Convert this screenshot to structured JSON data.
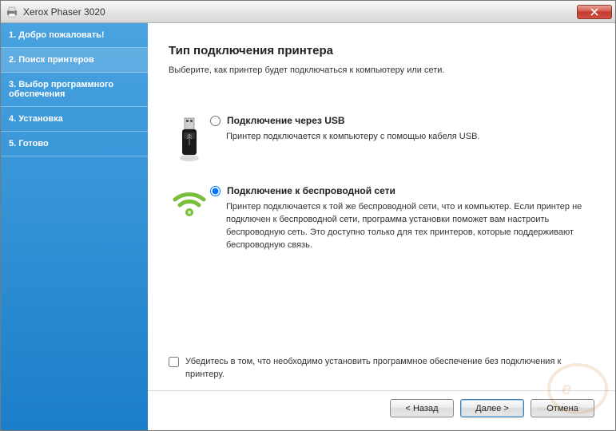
{
  "window": {
    "title": "Xerox Phaser 3020"
  },
  "sidebar": {
    "items": [
      {
        "label": "1. Добро пожаловать!"
      },
      {
        "label": "2. Поиск принтеров"
      },
      {
        "label": "3. Выбор программного обеспечения"
      },
      {
        "label": "4. Установка"
      },
      {
        "label": "5. Готово"
      }
    ]
  },
  "main": {
    "title": "Тип подключения принтера",
    "subtitle": "Выберите, как принтер будет подключаться к компьютеру или сети."
  },
  "options": {
    "usb": {
      "label": "Подключение через USB",
      "desc": "Принтер подключается к компьютеру с помощью кабеля USB."
    },
    "wifi": {
      "label": "Подключение к беспроводной сети",
      "desc": "Принтер подключается к той же беспроводной сети, что и компьютер. Если принтер не подключен к беспроводной сети, программа установки поможет вам настроить беспроводную сеть. Это доступно только для тех принтеров, которые поддерживают беспроводную связь."
    }
  },
  "checkbox": {
    "label": "Убедитесь в том, что необходимо установить программное обеспечение без подключения к принтеру."
  },
  "buttons": {
    "back": "< Назад",
    "next": "Далее >",
    "cancel": "Отмена"
  }
}
